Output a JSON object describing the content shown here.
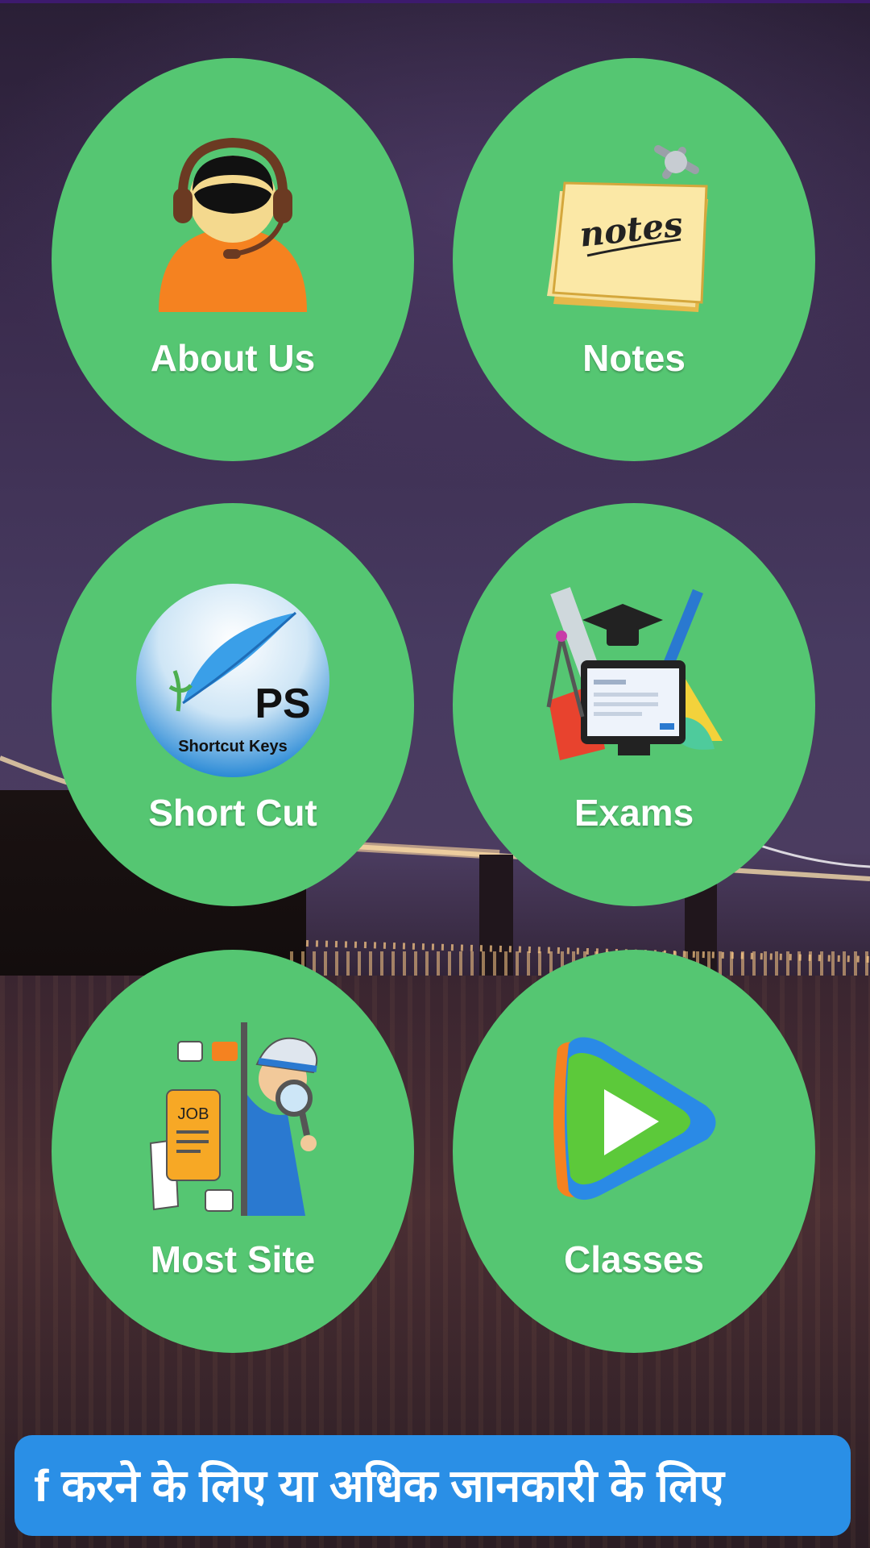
{
  "tiles": [
    {
      "label": "About Us",
      "icon": "support-agent-icon"
    },
    {
      "label": "Notes",
      "icon": "notes-pad-icon"
    },
    {
      "label": "Short Cut",
      "icon": "ps-shortcut-keys-icon",
      "icon_text": {
        "ps": "PS",
        "sub": "Shortcut Keys"
      }
    },
    {
      "label": "Exams",
      "icon": "exam-education-icon"
    },
    {
      "label": "Most Site",
      "icon": "job-search-detective-icon",
      "icon_text": {
        "job": "JOB"
      }
    },
    {
      "label": "Classes",
      "icon": "video-play-icon"
    }
  ],
  "notes_pad": {
    "text": "notes"
  },
  "marquee": {
    "text": "f करने के लिए या अधिक जानकारी के लिए"
  },
  "colors": {
    "tile": "#55c672",
    "marquee": "#2a8fe6",
    "label": "#ffffff"
  }
}
